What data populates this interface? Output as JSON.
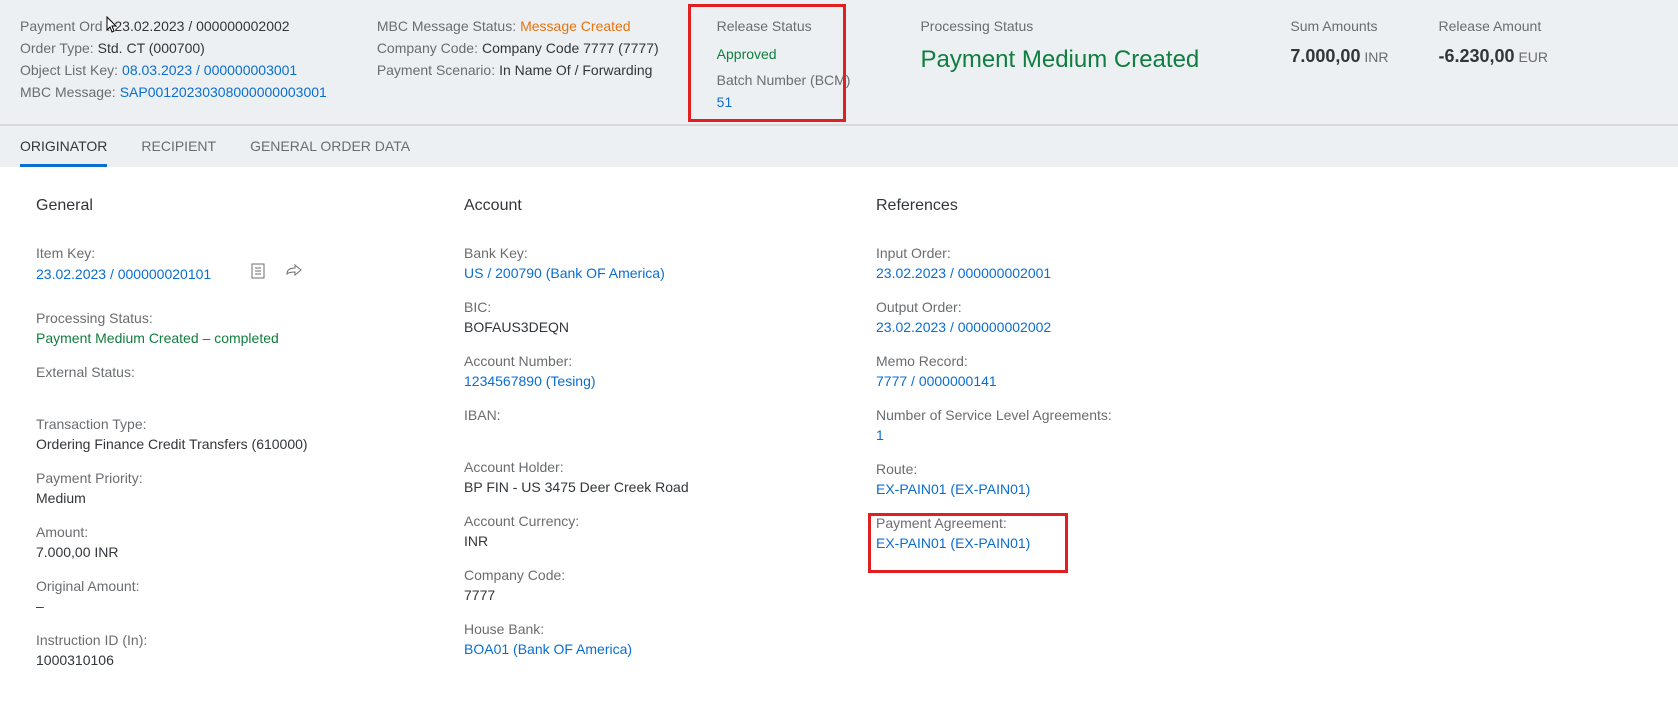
{
  "header": {
    "paymentOrder": {
      "label": "Payment Ord",
      "value": "23.02.2023 / 000000002002",
      "sep": ":"
    },
    "orderType": {
      "label": "Order Type:",
      "value": "Std. CT (000700)"
    },
    "objectListKey": {
      "label": "Object List Key:",
      "value": "08.03.2023 / 000000003001"
    },
    "mbcMessage": {
      "label": "MBC Message:",
      "value": "SAP00120230308000000003001"
    },
    "mbcMessageStatus": {
      "label": "MBC Message Status:",
      "value": "Message Created"
    },
    "companyCode": {
      "label": "Company Code:",
      "value": "Company Code 7777 (7777)"
    },
    "paymentScenario": {
      "label": "Payment Scenario:",
      "value": "In Name Of / Forwarding"
    },
    "releaseStatus": {
      "label": "Release Status",
      "value": "Approved"
    },
    "batchNumber": {
      "label": "Batch Number (BCM)",
      "value": "51"
    },
    "processingStatus": {
      "label": "Processing Status",
      "value": "Payment Medium Created"
    },
    "sumAmounts": {
      "label": "Sum Amounts",
      "value": "7.000,00",
      "currency": "INR"
    },
    "releaseAmount": {
      "label": "Release Amount",
      "value": "-6.230,00",
      "currency": "EUR"
    }
  },
  "tabs": {
    "originator": "ORIGINATOR",
    "recipient": "RECIPIENT",
    "generalOrderData": "GENERAL ORDER DATA"
  },
  "general": {
    "title": "General",
    "itemKey": {
      "label": "Item Key:",
      "value": "23.02.2023 / 000000020101"
    },
    "processingStatus": {
      "label": "Processing Status:",
      "value": "Payment Medium Created – completed"
    },
    "externalStatus": {
      "label": "External Status:"
    },
    "transactionType": {
      "label": "Transaction Type:",
      "value": "Ordering Finance Credit Transfers (610000)"
    },
    "paymentPriority": {
      "label": "Payment Priority:",
      "value": "Medium"
    },
    "amount": {
      "label": "Amount:",
      "value": "7.000,00  INR"
    },
    "originalAmount": {
      "label": "Original Amount:",
      "value": "–"
    },
    "instructionId": {
      "label": "Instruction ID (In):",
      "value": "1000310106"
    }
  },
  "account": {
    "title": "Account",
    "bankKey": {
      "label": "Bank Key:",
      "value": "US / 200790 (Bank OF America)"
    },
    "bic": {
      "label": "BIC:",
      "value": "BOFAUS3DEQN"
    },
    "accountNumber": {
      "label": "Account Number:",
      "value": "1234567890 (Tesing)"
    },
    "iban": {
      "label": "IBAN:"
    },
    "accountHolder": {
      "label": "Account Holder:",
      "value": "BP FIN - US 3475 Deer Creek Road"
    },
    "accountCurrency": {
      "label": "Account Currency:",
      "value": "INR"
    },
    "companyCode": {
      "label": "Company Code:",
      "value": "7777"
    },
    "houseBank": {
      "label": "House Bank:",
      "value": "BOA01 (Bank OF America)"
    }
  },
  "references": {
    "title": "References",
    "inputOrder": {
      "label": "Input Order:",
      "value": "23.02.2023 / 000000002001"
    },
    "outputOrder": {
      "label": "Output Order:",
      "value": "23.02.2023 / 000000002002"
    },
    "memoRecord": {
      "label": "Memo Record:",
      "value": "7777 / 0000000141"
    },
    "sla": {
      "label": "Number of Service Level Agreements:",
      "value": "1"
    },
    "route": {
      "label": "Route:",
      "value": "EX-PAIN01 (EX-PAIN01)"
    },
    "paymentAgreement": {
      "label": "Payment Agreement:",
      "value": "EX-PAIN01 (EX-PAIN01)"
    }
  }
}
